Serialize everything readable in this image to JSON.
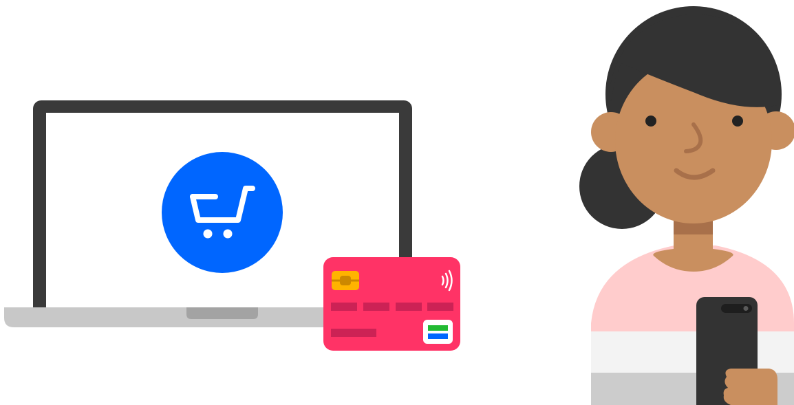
{
  "illustration": {
    "laptop": {
      "icon": "shopping-cart-icon",
      "frame_color": "#3a3a3a",
      "screen_color": "#ffffff",
      "base_color": "#c8c8c8",
      "cart_circle_color": "#0066ff"
    },
    "payment_card": {
      "icons": [
        "chip-icon",
        "contactless-icon",
        "card-logo-icon"
      ],
      "card_color": "#ff3366",
      "stripe_color": "#cc2255",
      "chip_color": "#ffb300"
    },
    "person": {
      "skin_color": "#c98f5f",
      "hair_color": "#333333",
      "shirt_colors": [
        "#ffcccc",
        "#f3f3f3",
        "#cccccc"
      ],
      "phone_color": "#333333"
    }
  }
}
